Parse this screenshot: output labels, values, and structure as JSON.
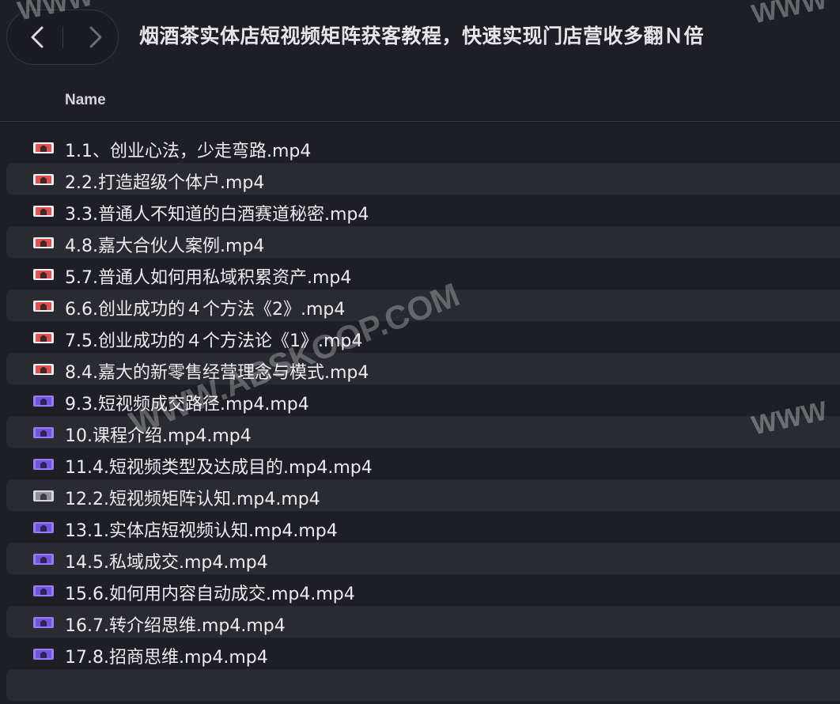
{
  "window": {
    "title": "烟酒茶实体店短视频矩阵获客教程，快速实现门店营收多翻Ｎ倍"
  },
  "navigation": {
    "back_icon": "chevron-left-icon",
    "forward_icon": "chevron-right-icon"
  },
  "columns": {
    "name": "Name"
  },
  "files": [
    {
      "name": "1.1、创业心法，少走弯路.mp4",
      "icon": "video-file-icon",
      "color": "red"
    },
    {
      "name": "2.2.打造超级个体户.mp4",
      "icon": "video-file-icon",
      "color": "red"
    },
    {
      "name": "3.3.普通人不知道的白酒赛道秘密.mp4",
      "icon": "video-file-icon",
      "color": "red"
    },
    {
      "name": "4.8.嘉大合伙人案例.mp4",
      "icon": "video-file-icon",
      "color": "red"
    },
    {
      "name": "5.7.普通人如何用私域积累资产.mp4",
      "icon": "video-file-icon",
      "color": "red"
    },
    {
      "name": "6.6.创业成功的４个方法《2》.mp4",
      "icon": "video-file-icon",
      "color": "red"
    },
    {
      "name": "7.5.创业成功的４个方法论《1》.mp4",
      "icon": "video-file-icon",
      "color": "red"
    },
    {
      "name": "8.4.嘉大的新零售经营理念与模式.mp4",
      "icon": "video-file-icon",
      "color": "red"
    },
    {
      "name": "9.3.短视频成交路径.mp4.mp4",
      "icon": "video-file-icon",
      "color": "purple"
    },
    {
      "name": "10.课程介绍.mp4.mp4",
      "icon": "video-file-icon",
      "color": "purple"
    },
    {
      "name": "11.4.短视频类型及达成目的.mp4.mp4",
      "icon": "video-file-icon",
      "color": "purple"
    },
    {
      "name": "12.2.短视频矩阵认知.mp4.mp4",
      "icon": "video-file-icon",
      "color": "grey"
    },
    {
      "name": "13.1.实体店短视频认知.mp4.mp4",
      "icon": "video-file-icon",
      "color": "purple"
    },
    {
      "name": "14.5.私域成交.mp4.mp4",
      "icon": "video-file-icon",
      "color": "purple"
    },
    {
      "name": "15.6.如何用内容自动成交.mp4.mp4",
      "icon": "video-file-icon",
      "color": "purple"
    },
    {
      "name": "16.7.转介绍思维.mp4.mp4",
      "icon": "video-file-icon",
      "color": "purple"
    },
    {
      "name": "17.8.招商思维.mp4.mp4",
      "icon": "video-file-icon",
      "color": "purple"
    }
  ],
  "watermarks": {
    "top_left": "WWW",
    "top_right": "WWW",
    "center": "WWW.ABSKOOP.COM",
    "right": "WWW"
  },
  "colors": {
    "background": "#1e1f24",
    "row_alt": "#2a2b31",
    "text": "#ececef"
  }
}
